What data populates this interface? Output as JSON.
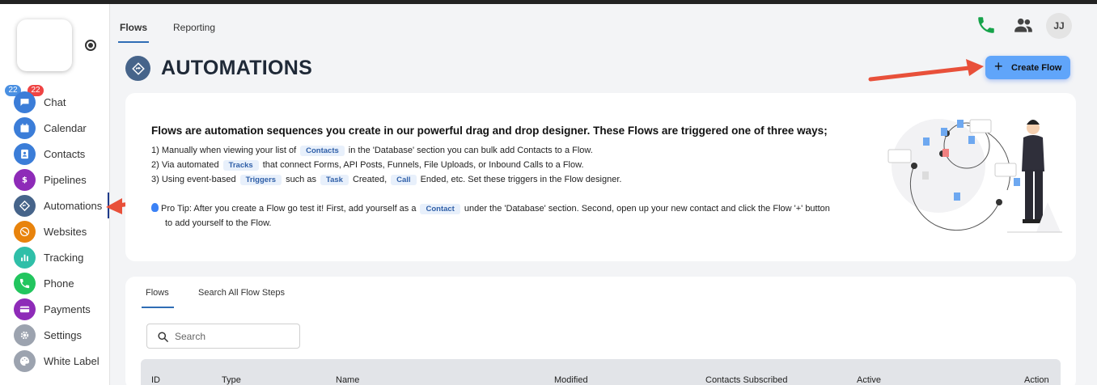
{
  "nav": {
    "badges": [
      "22",
      "22"
    ],
    "items": [
      {
        "label": "Chat",
        "icon": "chat-icon",
        "color": "#3b7dd8"
      },
      {
        "label": "Calendar",
        "icon": "calendar-icon",
        "color": "#3b7dd8"
      },
      {
        "label": "Contacts",
        "icon": "contacts-icon",
        "color": "#3b7dd8"
      },
      {
        "label": "Pipelines",
        "icon": "dollar-icon",
        "color": "#8e2bb8"
      },
      {
        "label": "Automations",
        "icon": "automation-icon",
        "color": "#46648a"
      },
      {
        "label": "Websites",
        "icon": "globe-icon",
        "color": "#e8830c"
      },
      {
        "label": "Tracking",
        "icon": "chart-icon",
        "color": "#2fbfa8"
      },
      {
        "label": "Phone",
        "icon": "phone-icon",
        "color": "#22c55e"
      },
      {
        "label": "Payments",
        "icon": "card-icon",
        "color": "#8e2bb8"
      },
      {
        "label": "Settings",
        "icon": "gear-icon",
        "color": "#9ca3af"
      },
      {
        "label": "White Label",
        "icon": "palette-icon",
        "color": "#9ca3af"
      }
    ]
  },
  "top_tabs": [
    "Flows",
    "Reporting"
  ],
  "header": {
    "avatar": "JJ",
    "title": "AUTOMATIONS",
    "create_label": "Create Flow"
  },
  "info": {
    "heading": "Flows are automation sequences you create in our powerful drag and drop designer. These Flows are triggered one of three ways;",
    "line1_a": "1) Manually when viewing your list of",
    "line1_chip": "Contacts",
    "line1_b": "in the 'Database' section you can bulk add Contacts to a Flow.",
    "line2_a": "2) Via automated",
    "line2_chip": "Tracks",
    "line2_b": "that connect Forms, API Posts, Funnels, File Uploads, or Inbound Calls to a Flow.",
    "line3_a": "3) Using event-based",
    "line3_chip1": "Triggers",
    "line3_b": "such as",
    "line3_chip2": "Task",
    "line3_c": "Created,",
    "line3_chip3": "Call",
    "line3_d": "Ended, etc. Set these triggers in the Flow designer.",
    "tip_a": "Pro Tip: After you create a Flow go test it! First, add yourself as a",
    "tip_chip": "Contact",
    "tip_b": "under the 'Database' section. Second, open up your new contact and click the Flow '+' button",
    "tip_c": "to add yourself to the Flow."
  },
  "flows": {
    "tabs": [
      "Flows",
      "Search All Flow Steps"
    ],
    "search_placeholder": "Search",
    "columns": [
      "ID",
      "Type",
      "Name",
      "Modified",
      "Contacts Subscribed",
      "Active",
      "Action"
    ]
  },
  "colors": {
    "accent": "#60a5fa",
    "arrow": "#e8503a",
    "tab_underline": "#2f6db5"
  }
}
